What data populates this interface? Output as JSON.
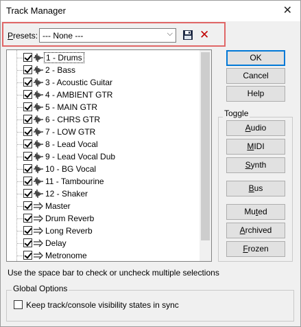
{
  "window": {
    "title": "Track Manager",
    "close_glyph": "✕"
  },
  "presets": {
    "label_prefix": "",
    "label_underlined": "P",
    "label_rest": "resets:",
    "selected": "--- None ---",
    "save_icon": "floppy-disk-icon",
    "delete_icon": "red-x-icon",
    "delete_glyph": "✕"
  },
  "tracks": [
    {
      "label": "1 - Drums",
      "type": "audio",
      "checked": true
    },
    {
      "label": "2 - Bass",
      "type": "audio",
      "checked": true
    },
    {
      "label": "3 - Acoustic Guitar",
      "type": "audio",
      "checked": true
    },
    {
      "label": "4 - AMBIENT GTR",
      "type": "audio",
      "checked": true
    },
    {
      "label": "5 - MAIN GTR",
      "type": "audio",
      "checked": true
    },
    {
      "label": "6 - CHRS GTR",
      "type": "audio",
      "checked": true
    },
    {
      "label": "7 - LOW GTR",
      "type": "audio",
      "checked": true
    },
    {
      "label": "8 - Lead Vocal",
      "type": "audio",
      "checked": true
    },
    {
      "label": "9 - Lead Vocal Dub",
      "type": "audio",
      "checked": true
    },
    {
      "label": "10 - BG Vocal",
      "type": "audio",
      "checked": true
    },
    {
      "label": "11 - Tambourine",
      "type": "audio",
      "checked": true
    },
    {
      "label": "12 - Shaker",
      "type": "audio",
      "checked": true
    },
    {
      "label": "Master",
      "type": "bus",
      "checked": true
    },
    {
      "label": "Drum Reverb",
      "type": "bus",
      "checked": true
    },
    {
      "label": "Long Reverb",
      "type": "bus",
      "checked": true
    },
    {
      "label": "Delay",
      "type": "bus",
      "checked": true
    },
    {
      "label": "Metronome",
      "type": "bus",
      "checked": true
    }
  ],
  "buttons": {
    "ok": "OK",
    "cancel": "Cancel",
    "help": "Help"
  },
  "toggle": {
    "title": "Toggle",
    "audio": "Audio",
    "midi": "MIDI",
    "synth": "Synth",
    "bus": "Bus",
    "muted": "Muted",
    "archived": "Archived",
    "frozen": "Frozen"
  },
  "hint": "Use the space bar to check or uncheck multiple selections",
  "global_options": {
    "title": "Global Options",
    "sync_label": "Keep track/console visibility states in sync",
    "sync_checked": false
  },
  "colors": {
    "highlight_box": "#e06666",
    "delete_red": "#c00000",
    "default_button_border": "#0078d7"
  }
}
